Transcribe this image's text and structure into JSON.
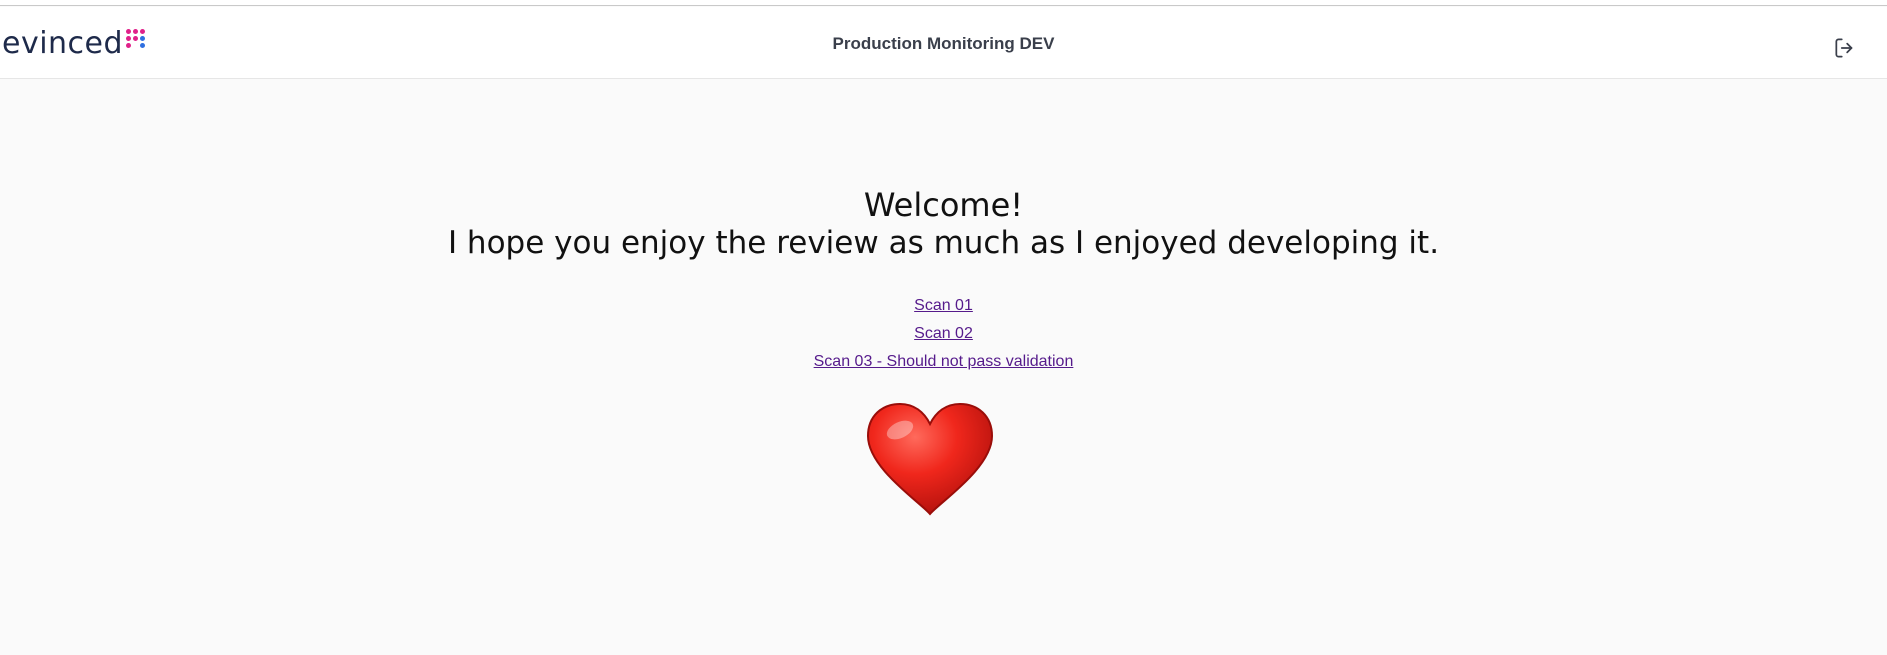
{
  "brand": {
    "logo_text": "evinced",
    "dot_colors": [
      "#e0218a",
      "#e0218a",
      "#e0218a",
      "#e0218a",
      "#e0218a",
      "#2f6fe0",
      "#e0218a",
      "#ffffff",
      "#2f6fe0"
    ]
  },
  "header": {
    "title": "Production Monitoring DEV",
    "logout_icon": "logout-icon"
  },
  "main": {
    "welcome": "Welcome!",
    "subtitle": "I hope you enjoy the review as much as I enjoyed developing it.",
    "links": [
      {
        "label": "Scan 01"
      },
      {
        "label": "Scan 02"
      },
      {
        "label": "Scan 03 - Should not pass validation"
      }
    ],
    "heart_icon": "heart-icon"
  },
  "colors": {
    "link": "#551a8b",
    "heading": "#111111",
    "heart": "#e0261c"
  }
}
